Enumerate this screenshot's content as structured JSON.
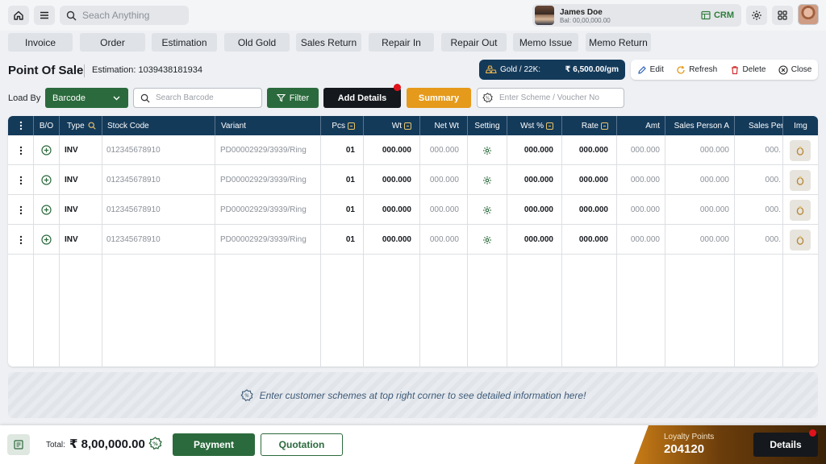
{
  "search": {
    "placeholder": "Seach Anything"
  },
  "user": {
    "name": "James Doe",
    "balance": "Bal: 00,00,000.00",
    "crm_label": "CRM"
  },
  "tabs": [
    "Invoice",
    "Order",
    "Estimation",
    "Old Gold",
    "Sales Return",
    "Repair In",
    "Repair Out",
    "Memo Issue",
    "Memo Return"
  ],
  "page": {
    "title": "Point Of Sale",
    "estimation": "Estimation: 1039438181934",
    "gold_label": "Gold / 22K:",
    "gold_price": "₹ 6,500.00/gm"
  },
  "actions": {
    "edit": "Edit",
    "refresh": "Refresh",
    "delete": "Delete",
    "close": "Close"
  },
  "loadby": {
    "label": "Load By",
    "selected": "Barcode",
    "barcode_placeholder": "Search Barcode",
    "filter": "Filter",
    "add_details": "Add Details",
    "summary": "Summary",
    "scheme_placeholder": "Enter Scheme / Voucher No"
  },
  "table": {
    "headers": [
      "B/O",
      "Type",
      "Stock Code",
      "Variant",
      "Pcs",
      "Wt",
      "Net Wt",
      "Setting",
      "Wst %",
      "Rate",
      "Amt",
      "Sales Person A",
      "Sales Pers",
      "Img"
    ],
    "rows": [
      {
        "type": "INV",
        "stock_code": "012345678910",
        "variant": "PD00002929/3939/Ring",
        "pcs": "01",
        "wt": "000.000",
        "net_wt": "000.000",
        "wst": "000.000",
        "rate": "000.000",
        "amt": "000.000",
        "sp_a": "000.000",
        "sp_b": "000."
      },
      {
        "type": "INV",
        "stock_code": "012345678910",
        "variant": "PD00002929/3939/Ring",
        "pcs": "01",
        "wt": "000.000",
        "net_wt": "000.000",
        "wst": "000.000",
        "rate": "000.000",
        "amt": "000.000",
        "sp_a": "000.000",
        "sp_b": "000."
      },
      {
        "type": "INV",
        "stock_code": "012345678910",
        "variant": "PD00002929/3939/Ring",
        "pcs": "01",
        "wt": "000.000",
        "net_wt": "000.000",
        "wst": "000.000",
        "rate": "000.000",
        "amt": "000.000",
        "sp_a": "000.000",
        "sp_b": "000."
      },
      {
        "type": "INV",
        "stock_code": "012345678910",
        "variant": "PD00002929/3939/Ring",
        "pcs": "01",
        "wt": "000.000",
        "net_wt": "000.000",
        "wst": "000.000",
        "rate": "000.000",
        "amt": "000.000",
        "sp_a": "000.000",
        "sp_b": "000."
      }
    ]
  },
  "banner": {
    "text": "Enter customer schemes at top right corner to see detailed information here!"
  },
  "footer": {
    "total_label": "Total:",
    "total_value": "₹ 8,00,000.00",
    "payment": "Payment",
    "quotation": "Quotation",
    "loyalty_label": "Loyalty Points",
    "loyalty_value": "204120",
    "details": "Details"
  },
  "colors": {
    "navy": "#143a5a",
    "green": "#2b6a3c",
    "orange": "#e59a1c",
    "dark": "#15181d",
    "alert": "#e0121b"
  }
}
